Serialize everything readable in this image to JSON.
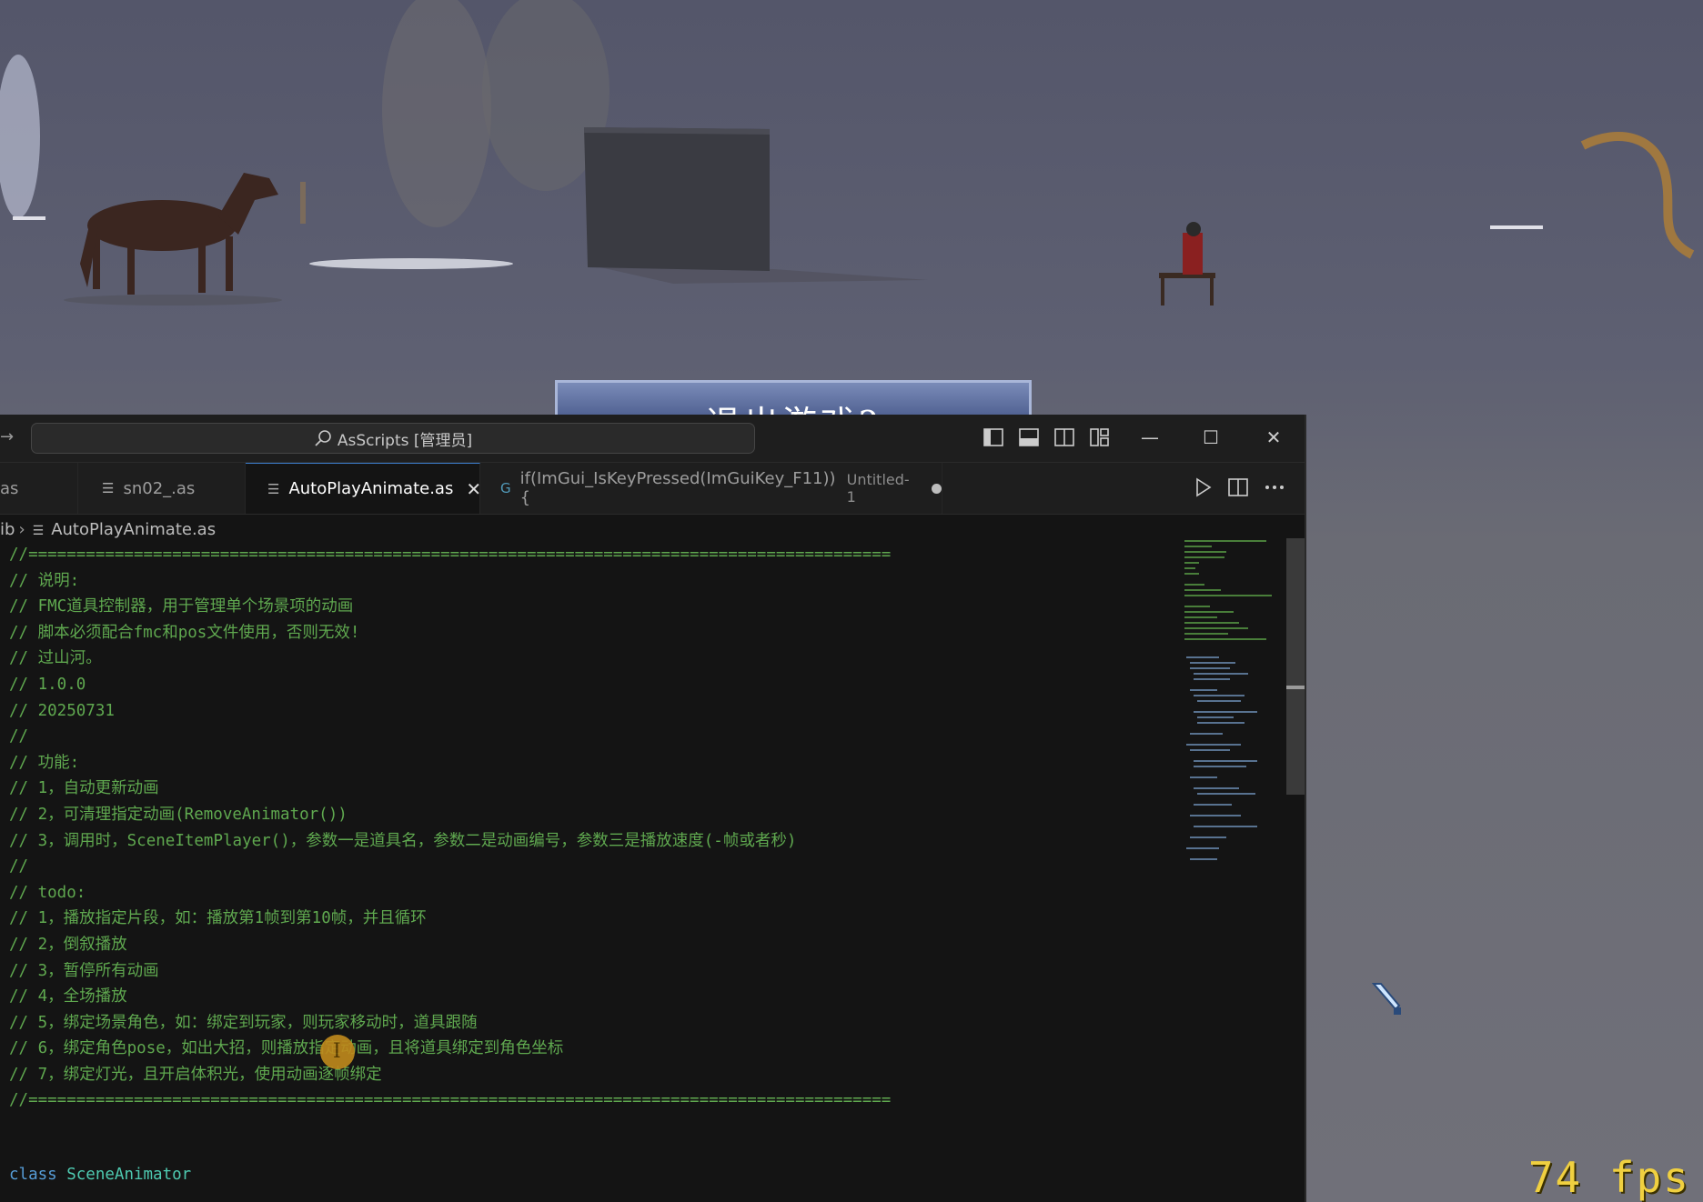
{
  "titlebar": {
    "search_label": "AsScripts [管理员]"
  },
  "tabs": [
    {
      "label": "as"
    },
    {
      "label": "sn02_.as"
    },
    {
      "label": "AutoPlayAnimate.as",
      "close": "✕"
    },
    {
      "label": "if(ImGui_IsKeyPressed(ImGuiKey_F11)){",
      "desc": "Untitled-1"
    }
  ],
  "breadcrumb": {
    "parent": "ib",
    "file": "AutoPlayAnimate.as"
  },
  "code_lines": [
    "//==========================================================================================",
    "// 说明:",
    "// FMC道具控制器，用于管理单个场景项的动画",
    "// 脚本必须配合fmc和pos文件使用，否则无效!",
    "// 过山河。",
    "// 1.0.0",
    "// 20250731",
    "//",
    "// 功能:",
    "// 1，自动更新动画",
    "// 2，可清理指定动画(RemoveAnimator())",
    "// 3，调用时，SceneItemPlayer()，参数一是道具名，参数二是动画编号，参数三是播放速度(-帧或者秒)",
    "//",
    "// todo:",
    "// 1，播放指定片段，如：播放第1帧到第10帧，并且循环",
    "// 2，倒叙播放",
    "// 3，暂停所有动画",
    "// 4，全场播放",
    "// 5，绑定场景角色，如：绑定到玩家，则玩家移动时，道具跟随",
    "// 6，绑定角色pose，如出大招，则播放指定动画，且将道具绑定到角色坐标",
    "// 7，绑定灯光，且开启体积光，使用动画逐帧绑定",
    "//=========================================================================================="
  ],
  "class_line": {
    "keyword": "class",
    "name": "SceneAnimator"
  },
  "game": {
    "banner_text": "退出游戏?",
    "fps": "74 fps"
  },
  "colors": {
    "editor_bg": "#141414",
    "comment": "#5fa84f",
    "keyword": "#569cd6",
    "class_name": "#4ec9b0",
    "fps": "#f0d040",
    "active_tab_border": "#3d7fd1"
  }
}
